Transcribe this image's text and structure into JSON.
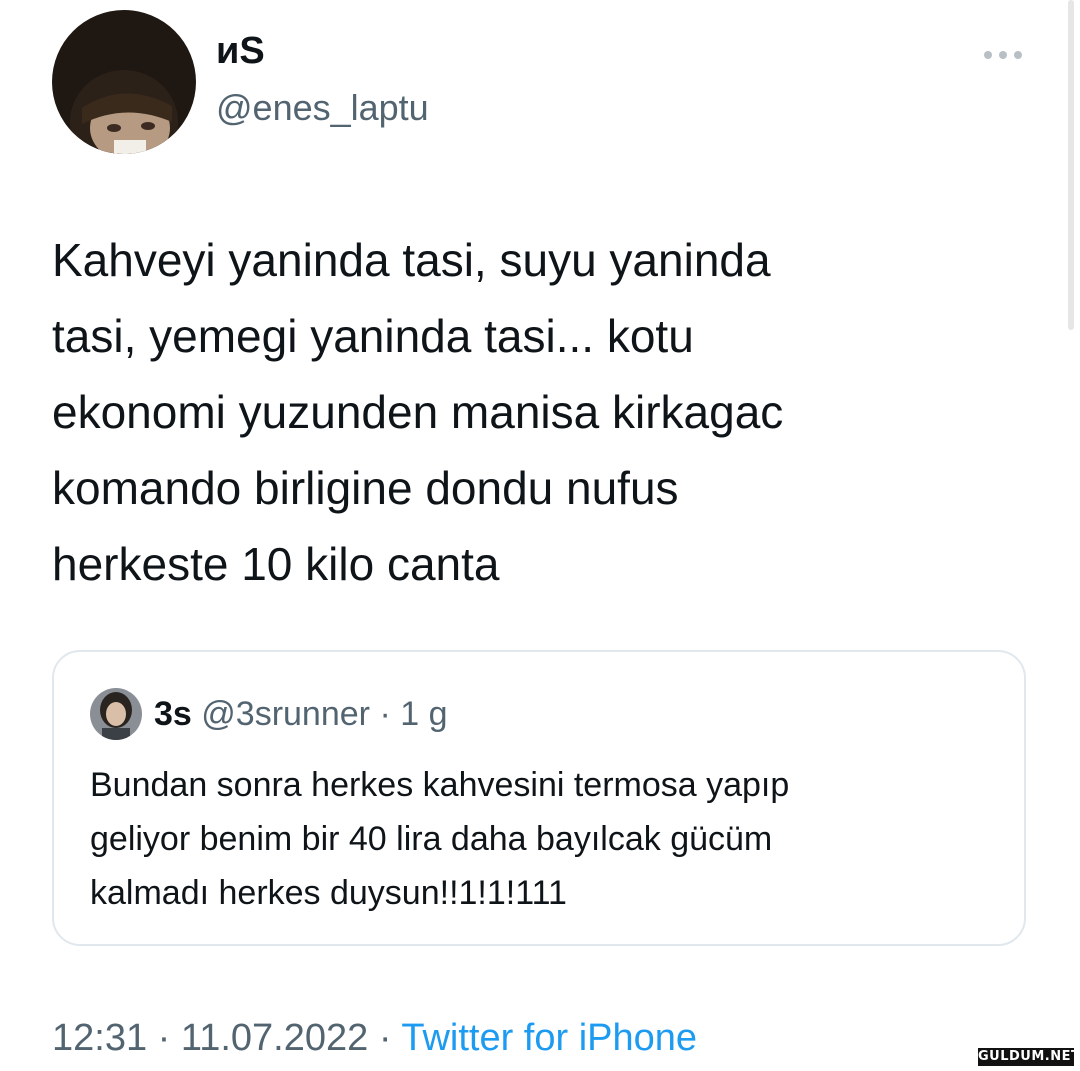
{
  "tweet": {
    "display_name": "ᴎS",
    "handle": "@enes_laptu",
    "more_icon": "more-horizontal-icon",
    "text_lines": [
      "Kahveyi yaninda tasi, suyu yaninda",
      "tasi, yemegi yaninda tasi... kotu",
      "ekonomi yuzunden manisa kirkagac",
      "komando birligine dondu nufus",
      "herkeste 10 kilo canta"
    ],
    "time": "12:31",
    "separator": "·",
    "date": "11.07.2022",
    "source": "Twitter for iPhone"
  },
  "quote": {
    "name": "3s",
    "handle": "@3srunner",
    "separator": "·",
    "age": "1 g",
    "text_lines": [
      "Bundan sonra herkes kahvesini termosa yapıp",
      "geliyor benim bir 40 lira daha bayılcak gücüm",
      "kalmadı herkes duysun!!1!1!111"
    ]
  },
  "watermark": "GULDUM.NET",
  "colors": {
    "text": "#0f1419",
    "secondary": "#536471",
    "link": "#1d9bf0",
    "border": "#e1e8ed"
  }
}
